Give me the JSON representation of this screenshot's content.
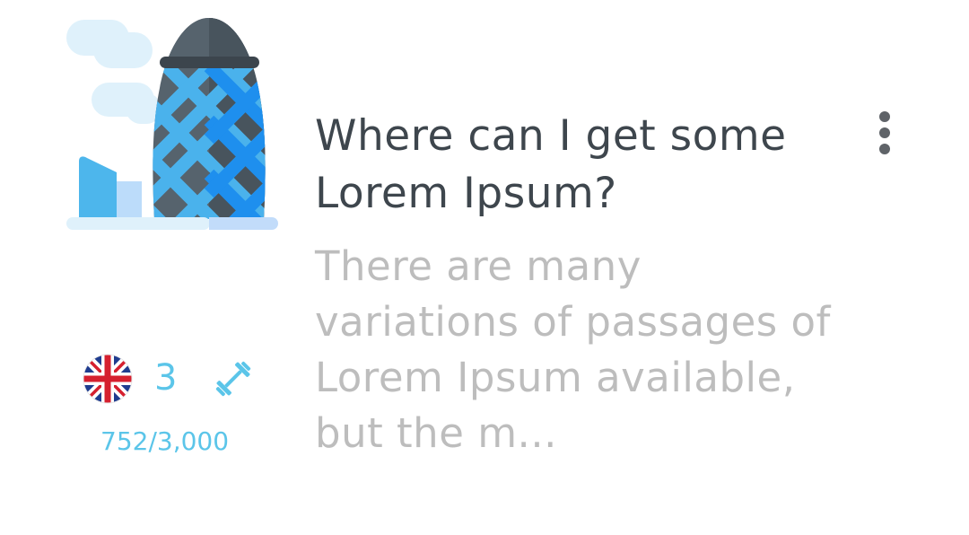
{
  "card": {
    "illustration_icon": "gherkin-building-icon",
    "language_icon": "uk-flag-icon",
    "level_number": "3",
    "workout_icon": "dumbbell-icon",
    "progress_text": "752/3,000",
    "title": "Where can I get some Lorem Ipsum?",
    "description": "There are many variations of passages of Lorem Ipsum available, but the m...",
    "menu_icon": "more-vertical-icon"
  },
  "colors": {
    "accent": "#5bc5e9",
    "title_text": "#3e464d",
    "description_text": "#bdbdbd",
    "menu_icon": "#5f6368"
  }
}
